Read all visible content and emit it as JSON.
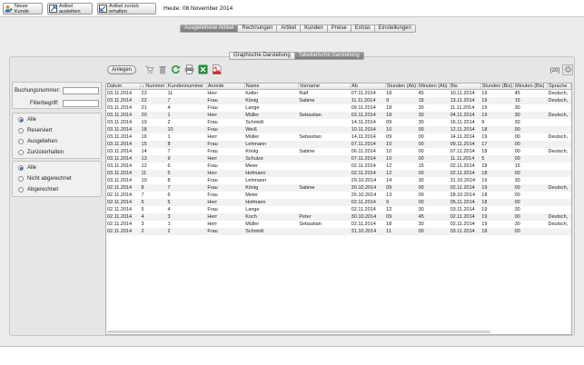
{
  "toolbar": {
    "new_customer": "Neuer Kunde",
    "lend_article": "Artikel ausleihen",
    "return_article": "Artikel zurück erhalten",
    "today": "Heute: 08 November 2014"
  },
  "main_tabs": [
    {
      "label": "Ausgeliehene Artikel",
      "active": true
    },
    {
      "label": "Rechnungen",
      "active": false
    },
    {
      "label": "Artikel",
      "active": false
    },
    {
      "label": "Kunden",
      "active": false
    },
    {
      "label": "Preise",
      "active": false
    },
    {
      "label": "Extras",
      "active": false
    },
    {
      "label": "Einstellungen",
      "active": false
    }
  ],
  "sub_tabs": [
    {
      "label": "Graphische Darstellung",
      "active": false
    },
    {
      "label": "Tabellarische Darstellung",
      "active": true
    }
  ],
  "actions": {
    "create": "Anlegen",
    "count": "[20]"
  },
  "filters": {
    "booking_label": "Buchungsnummer:",
    "booking_value": "",
    "filter_label": "Filterbegriff:",
    "filter_value": "",
    "status_options": [
      {
        "label": "Alle",
        "selected": true
      },
      {
        "label": "Reserviert",
        "selected": false
      },
      {
        "label": "Ausgeliehen",
        "selected": false
      },
      {
        "label": "Zurückerhalten",
        "selected": false
      }
    ],
    "billing_options": [
      {
        "label": "Alle",
        "selected": true
      },
      {
        "label": "Nicht abgerechnet",
        "selected": false
      },
      {
        "label": "Abgerechnet",
        "selected": false
      }
    ]
  },
  "table": {
    "columns": [
      "Datum",
      "↓ Nummer",
      "Kundennummer",
      "Anrede",
      "Name",
      "Vorname",
      "Ab",
      "Stunden (Ab)",
      "Minuten (Ab)",
      "Bis",
      "Stunden (Bis)",
      "Minuten (Bis)",
      "Sprache"
    ],
    "rows": [
      [
        "03.11.2014",
        "23",
        "11",
        "Herr",
        "Keller",
        "Ralf",
        "07.11.2014",
        "18",
        "45",
        "10.11.2014",
        "19",
        "45",
        "Deutsch,"
      ],
      [
        "03.11.2014",
        "22",
        "7",
        "Frau",
        "König",
        "Sabine",
        "11.11.2014",
        "9",
        "15",
        "13.11.2014",
        "19",
        "15",
        "Deutsch,"
      ],
      [
        "03.11.2014",
        "21",
        "4",
        "Frau",
        "Lange",
        "",
        "09.11.2014",
        "18",
        "30",
        "11.11.2014",
        "19",
        "30",
        ""
      ],
      [
        "03.11.2014",
        "20",
        "1",
        "Herr",
        "Müller",
        "Sebastian",
        "03.11.2014",
        "18",
        "30",
        "04.11.2014",
        "19",
        "30",
        "Deutsch,"
      ],
      [
        "03.11.2014",
        "19",
        "2",
        "Frau",
        "Schmidt",
        "",
        "14.11.2014",
        "09",
        "30",
        "16.11.2014",
        "9",
        "30",
        ""
      ],
      [
        "03.11.2014",
        "18",
        "10",
        "Frau",
        "Weiß",
        "",
        "10.11.2014",
        "10",
        "00",
        "12.11.2014",
        "18",
        "00",
        ""
      ],
      [
        "03.11.2014",
        "16",
        "1",
        "Herr",
        "Müller",
        "Sebastian",
        "14.11.2014",
        "09",
        "00",
        "14.11.2014",
        "19",
        "00",
        "Deutsch,"
      ],
      [
        "03.11.2014",
        "15",
        "8",
        "Frau",
        "Lehmann",
        "",
        "07.11.2014",
        "10",
        "00",
        "09.11.2014",
        "17",
        "00",
        ""
      ],
      [
        "03.11.2014",
        "14",
        "7",
        "Frau",
        "König",
        "Sabine",
        "06.11.2014",
        "10",
        "00",
        "07.11.2014",
        "18",
        "00",
        "Deutsch,"
      ],
      [
        "03.11.2014",
        "13",
        "9",
        "Herr",
        "Schulze",
        "",
        "07.11.2014",
        "10",
        "00",
        "11.11.2014",
        "5",
        "00",
        ""
      ],
      [
        "03.11.2014",
        "12",
        "6",
        "Frau",
        "Meier",
        "",
        "02.11.2014",
        "12",
        "15",
        "02.11.2014",
        "18",
        "15",
        ""
      ],
      [
        "03.11.2014",
        "11",
        "5",
        "Herr",
        "Hofmann",
        "",
        "02.11.2014",
        "12",
        "00",
        "02.11.2014",
        "18",
        "00",
        ""
      ],
      [
        "03.11.2014",
        "10",
        "8",
        "Frau",
        "Lehmann",
        "",
        "29.10.2014",
        "14",
        "30",
        "31.10.2014",
        "19",
        "30",
        ""
      ],
      [
        "02.11.2014",
        "8",
        "7",
        "Frau",
        "König",
        "Sabine",
        "30.10.2014",
        "09",
        "00",
        "02.11.2014",
        "19",
        "00",
        "Deutsch,"
      ],
      [
        "02.11.2014",
        "7",
        "6",
        "Frau",
        "Meier",
        "",
        "26.10.2014",
        "13",
        "00",
        "28.10.2014",
        "18",
        "00",
        ""
      ],
      [
        "02.11.2014",
        "6",
        "5",
        "Herr",
        "Hofmann",
        "",
        "02.11.2014",
        "9",
        "00",
        "05.11.2014",
        "18",
        "00",
        ""
      ],
      [
        "02.11.2014",
        "5",
        "4",
        "Frau",
        "Lange",
        "",
        "02.11.2014",
        "12",
        "30",
        "03.11.2014",
        "19",
        "30",
        ""
      ],
      [
        "02.11.2014",
        "4",
        "3",
        "Herr",
        "Koch",
        "Peter",
        "30.10.2014",
        "09",
        "45",
        "02.11.2014",
        "19",
        "00",
        "Deutsch,"
      ],
      [
        "02.11.2014",
        "3",
        "1",
        "Herr",
        "Müller",
        "Sebastian",
        "02.11.2014",
        "18",
        "30",
        "02.11.2014",
        "19",
        "30",
        "Deutsch,"
      ],
      [
        "02.11.2014",
        "2",
        "2",
        "Frau",
        "Schmidt",
        "",
        "31.10.2014",
        "11",
        "00",
        "03.11.2014",
        "18",
        "00",
        ""
      ]
    ]
  }
}
